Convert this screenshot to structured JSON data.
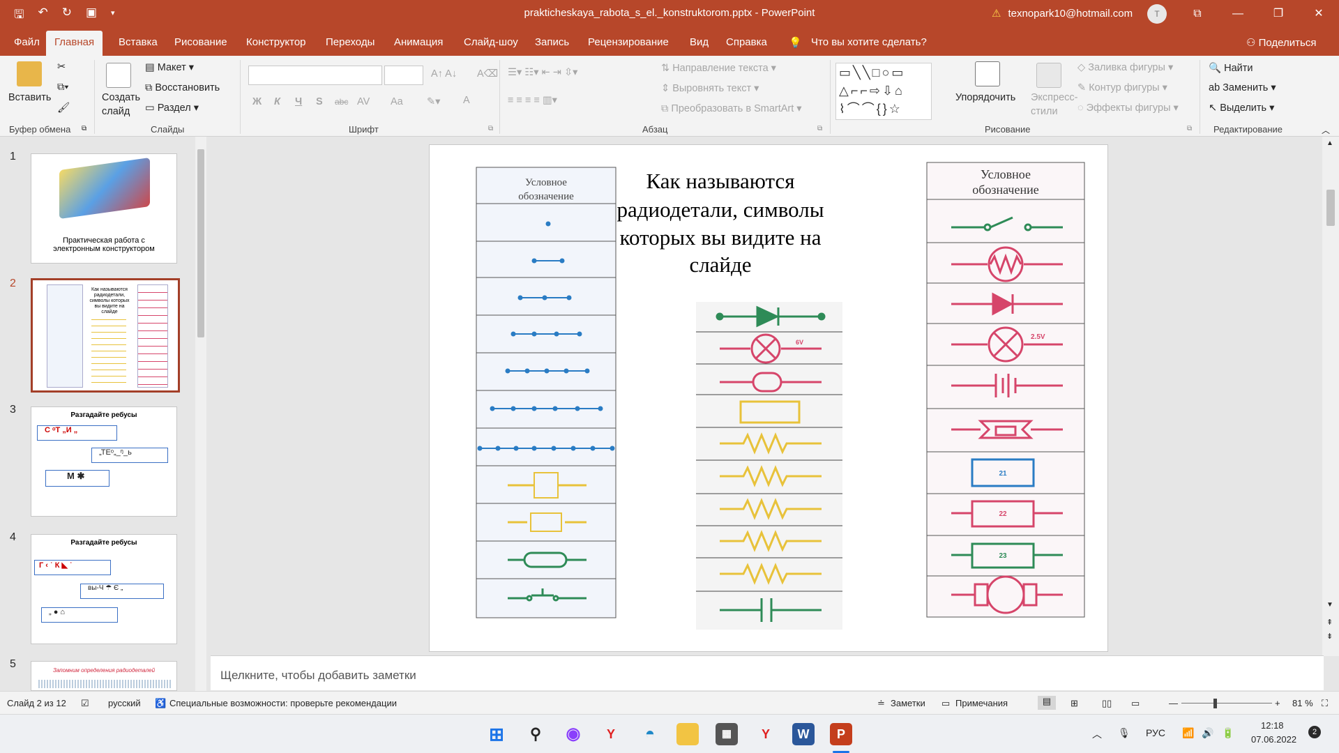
{
  "window": {
    "title": "prakticheskaya_rabota_s_el._konstruktorom.pptx  -  PowerPoint",
    "account": "texnopark10@hotmail.com",
    "avatar": "Т"
  },
  "tabs": [
    "Файл",
    "Главная",
    "Вставка",
    "Рисование",
    "Конструктор",
    "Переходы",
    "Анимация",
    "Слайд-шоу",
    "Запись",
    "Рецензирование",
    "Вид",
    "Справка"
  ],
  "active_tab": "Главная",
  "tell_me": "Что вы хотите сделать?",
  "share": "Поделиться",
  "ribbon": {
    "clipboard": {
      "paste": "Вставить",
      "group": "Буфер обмена"
    },
    "slides": {
      "new_slide_1": "Создать",
      "new_slide_2": "слайд",
      "layout": "Макет",
      "reset": "Восстановить",
      "section": "Раздел",
      "group": "Слайды"
    },
    "font": {
      "group": "Шрифт",
      "bold": "Ж",
      "italic": "К",
      "underline": "Ч",
      "shadow": "S",
      "strike": "abc",
      "spacing": "AV",
      "case": "Aa",
      "color": "A"
    },
    "paragraph": {
      "text_direction": "Направление текста",
      "align_text": "Выровнять текст",
      "smartart": "Преобразовать в SmartArt",
      "group": "Абзац"
    },
    "drawing": {
      "arrange": "Упорядочить",
      "quick_styles_1": "Экспресс-",
      "quick_styles_2": "стили",
      "fill": "Заливка фигуры",
      "outline": "Контур фигуры",
      "effects": "Эффекты фигуры",
      "group": "Рисование"
    },
    "editing": {
      "find": "Найти",
      "replace": "Заменить",
      "select": "Выделить",
      "group": "Редактирование"
    }
  },
  "thumbnails": [
    {
      "num": "1",
      "caption": "Практическая работа с электронным конструктором"
    },
    {
      "num": "2",
      "caption": ""
    },
    {
      "num": "3",
      "caption": "Разгадайте ребусы"
    },
    {
      "num": "4",
      "caption": "Разгадайте ребусы"
    },
    {
      "num": "5",
      "caption": "Запомним определения радиодеталей"
    }
  ],
  "slide": {
    "title": "Как  называются радиодетали,  символы которых вы видите на слайде",
    "left_header": "Условное обозначение",
    "right_header": "Условное обозначение",
    "labels": {
      "6v": "6V",
      "2_5v": "2.5V",
      "n21": "21",
      "n22": "22",
      "n23": "23"
    }
  },
  "notes_placeholder": "Щелкните, чтобы добавить заметки",
  "status": {
    "slide": "Слайд 2 из 12",
    "language": "русский",
    "accessibility": "Специальные возможности: проверьте рекомендации",
    "notes": "Заметки",
    "comments": "Примечания",
    "zoom": "81 %"
  },
  "taskbar": {
    "lang": "РУС",
    "time": "12:18",
    "date": "07.06.2022",
    "notif": "2"
  },
  "colors": {
    "accent": "#b7472a",
    "green": "#2e8b57",
    "pink": "#d6456a",
    "blue": "#2a7cc4",
    "yellow": "#e8c23a"
  }
}
